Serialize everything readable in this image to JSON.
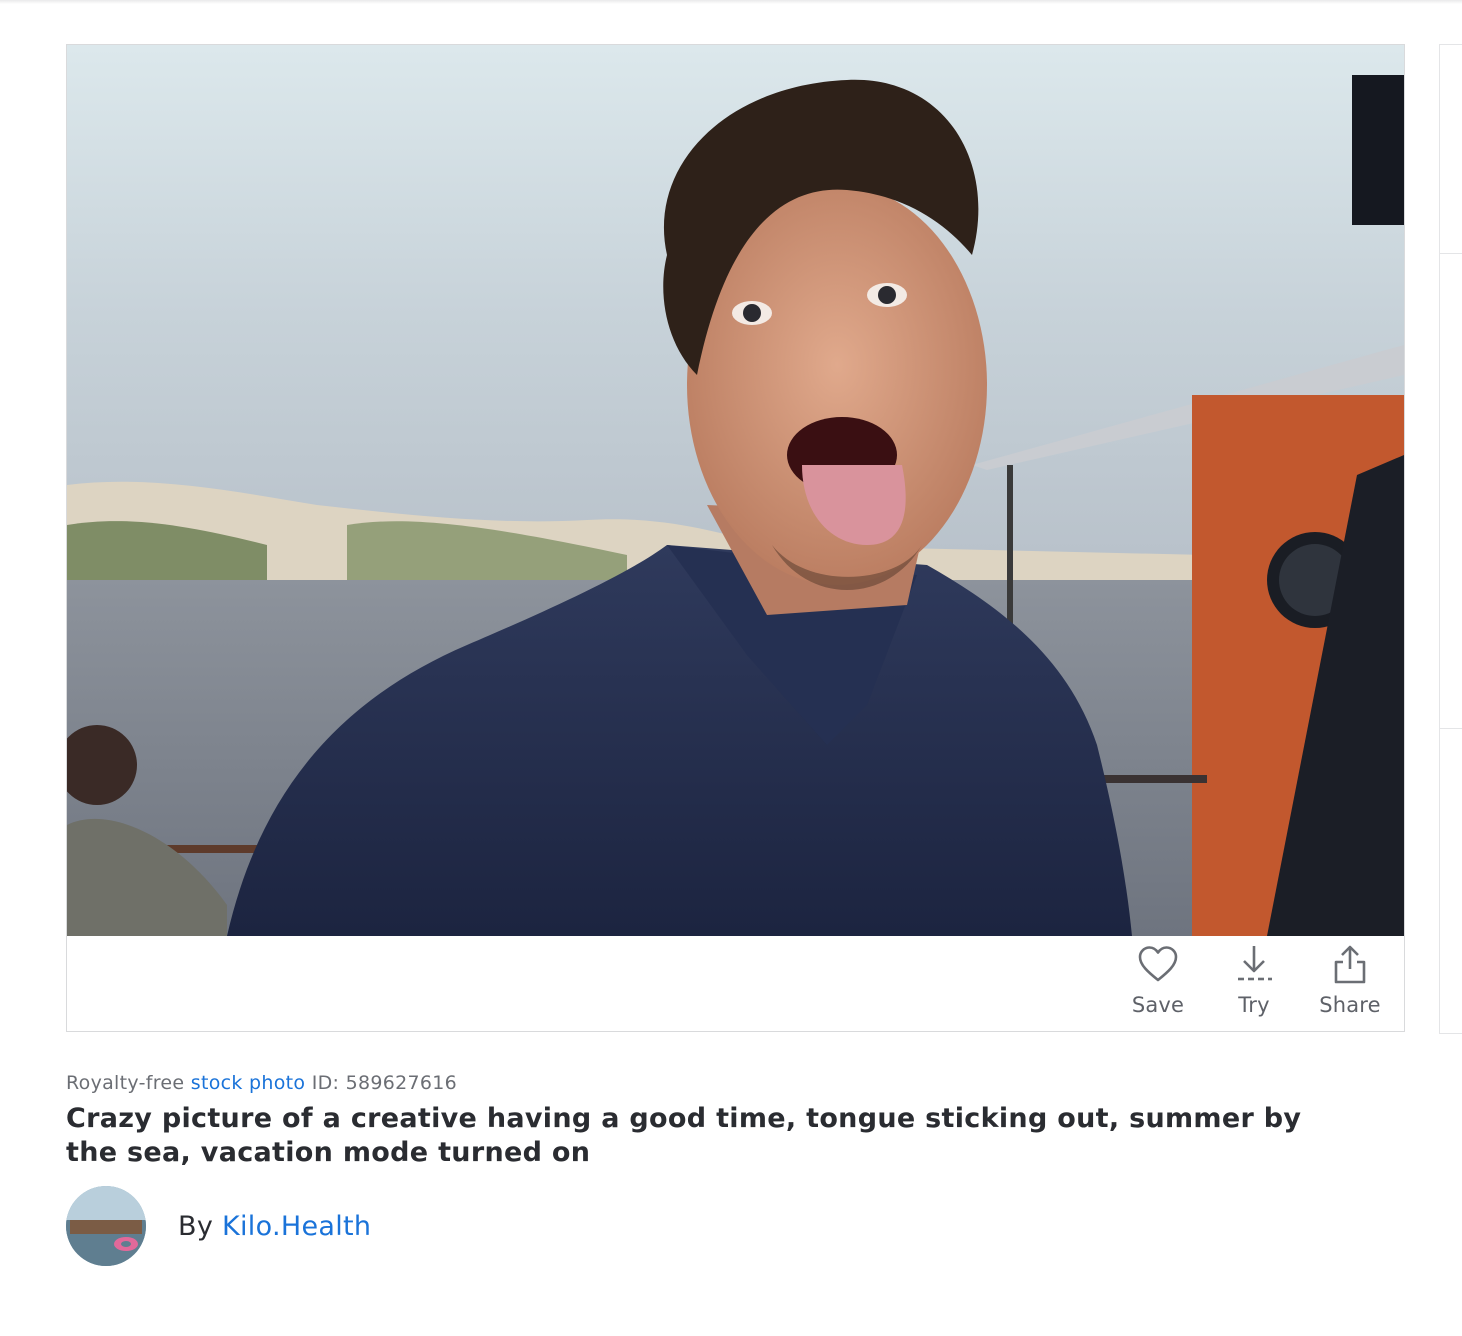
{
  "actions": {
    "save": {
      "label": "Save",
      "icon": "heart-icon"
    },
    "try": {
      "label": "Try",
      "icon": "download-icon"
    },
    "share": {
      "label": "Share",
      "icon": "share-icon"
    }
  },
  "meta": {
    "prefix": "Royalty-free",
    "type_link": "stock photo",
    "id_label": "ID:",
    "id_value": "589627616"
  },
  "title": "Crazy picture of a creative having a good time, tongue sticking out, summer by the sea, vacation mode turned on",
  "author": {
    "by_label": "By",
    "name": "Kilo.Health"
  },
  "colors": {
    "link": "#1a73d9",
    "text": "#2a2c31",
    "muted": "#6b6e74"
  }
}
